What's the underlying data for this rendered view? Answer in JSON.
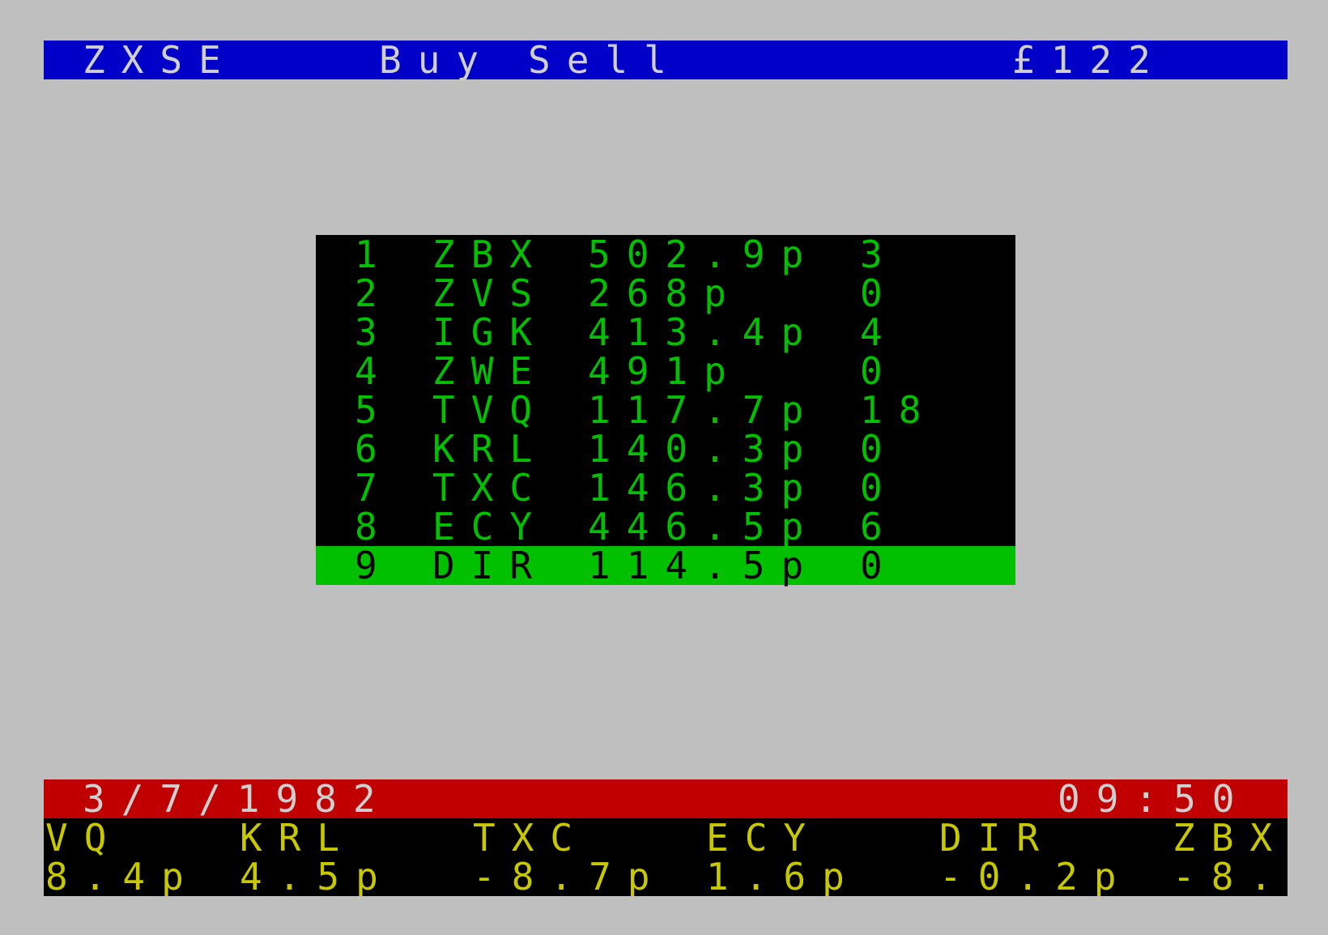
{
  "header": {
    "title": "ZXSE",
    "buy_label": "Buy",
    "sell_label": "Sell",
    "cash": "£122"
  },
  "stocks": [
    {
      "num": "1",
      "symbol": "ZBX",
      "price": "502.9p",
      "held": "3"
    },
    {
      "num": "2",
      "symbol": "ZVS",
      "price": "268p",
      "held": "0"
    },
    {
      "num": "3",
      "symbol": "IGK",
      "price": "413.4p",
      "held": "4"
    },
    {
      "num": "4",
      "symbol": "ZWE",
      "price": "491p",
      "held": "0"
    },
    {
      "num": "5",
      "symbol": "TVQ",
      "price": "117.7p",
      "held": "18"
    },
    {
      "num": "6",
      "symbol": "KRL",
      "price": "140.3p",
      "held": "0"
    },
    {
      "num": "7",
      "symbol": "TXC",
      "price": "146.3p",
      "held": "0"
    },
    {
      "num": "8",
      "symbol": "ECY",
      "price": "446.5p",
      "held": "6"
    },
    {
      "num": "9",
      "symbol": "DIR",
      "price": "114.5p",
      "held": "0"
    }
  ],
  "selected_row": "9",
  "status": {
    "date": "3/7/1982",
    "time": "09:50"
  },
  "ticker": [
    {
      "symbol": "VQ",
      "change": "8.4p"
    },
    {
      "symbol": "KRL",
      "change": "4.5p"
    },
    {
      "symbol": "TXC",
      "change": "-8.7p"
    },
    {
      "symbol": "ECY",
      "change": "1.6p"
    },
    {
      "symbol": "DIR",
      "change": "-0.2p"
    },
    {
      "symbol": "ZBX",
      "change": "-8."
    }
  ],
  "colors": {
    "background": "#bfbfbf",
    "header_bar": "#0000c8",
    "status_bar": "#c00000",
    "table_text": "#00c000",
    "selection": "#00c000",
    "ticker_text": "#c8c800",
    "bar_text": "#cfcfcf"
  }
}
